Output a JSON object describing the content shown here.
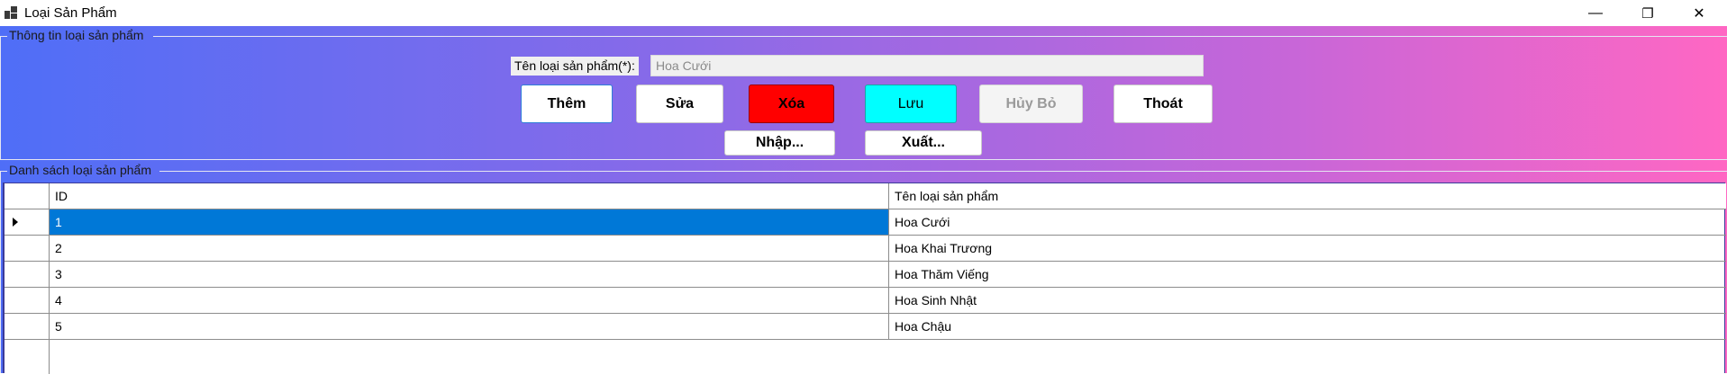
{
  "window": {
    "title": "Loại Sản Phẩm",
    "minimize_glyph": "—",
    "restore_glyph": "❐",
    "close_glyph": "✕"
  },
  "info_group": {
    "title": "Thông tin loại sản phẩm",
    "field_label": "Tên loại sản phẩm(*):",
    "field_value": "Hoa Cưới"
  },
  "buttons": {
    "them": "Thêm",
    "sua": "Sửa",
    "xoa": "Xóa",
    "luu": "Lưu",
    "huybo": "Hủy Bỏ",
    "thoat": "Thoát",
    "nhap": "Nhập...",
    "xuat": "Xuất..."
  },
  "colors": {
    "xoa_bg": "#ff0000",
    "luu_bg": "#00ffff",
    "selection": "#0078d7",
    "gradient_start": "#4f6ef7",
    "gradient_end": "#ff67c3"
  },
  "list_group": {
    "title": "Danh sách loại sản phẩm",
    "columns": [
      "ID",
      "Tên loại sản phẩm"
    ],
    "rows": [
      {
        "id": "1",
        "name": "Hoa Cưới",
        "selected": true
      },
      {
        "id": "2",
        "name": "Hoa Khai Trương",
        "selected": false
      },
      {
        "id": "3",
        "name": "Hoa Thăm Viếng",
        "selected": false
      },
      {
        "id": "4",
        "name": "Hoa Sinh Nhật",
        "selected": false
      },
      {
        "id": "5",
        "name": "Hoa Chậu",
        "selected": false
      }
    ]
  }
}
